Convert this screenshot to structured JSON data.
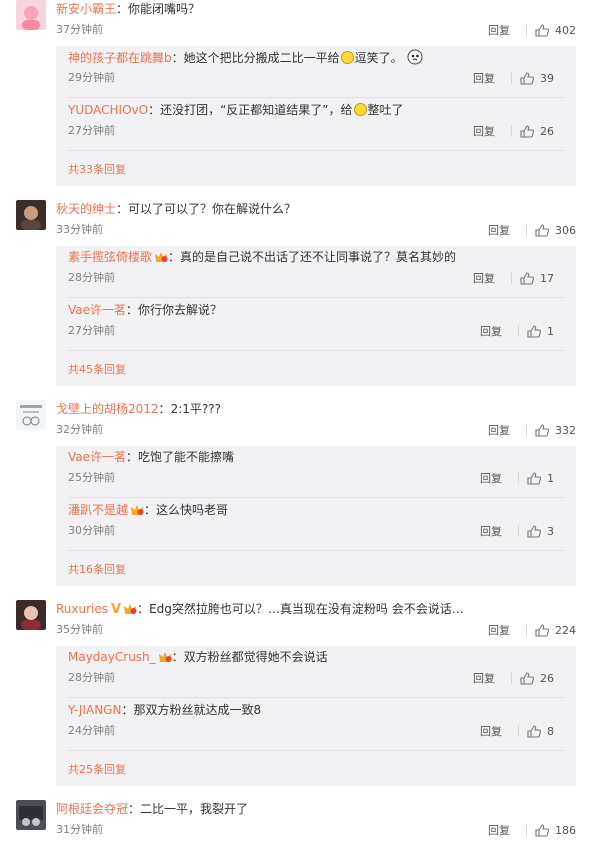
{
  "labels": {
    "reply": "回复"
  },
  "comments": [
    {
      "user": "新安小霸王",
      "text": "你能闭嘴吗？",
      "time": "37分钟前",
      "likes": "402",
      "replies": [
        {
          "user": "神的孩子都在跳舞b",
          "text": "她这个把比分搬成二比一平给",
          "text_after": "逗笑了。",
          "time": "29分钟前",
          "likes": "39"
        },
        {
          "user": "YUDACHIOvO",
          "text": "还没打团，“反正都知道结果了”，给",
          "text_after": "整吐了",
          "time": "27分钟前",
          "likes": "26"
        }
      ],
      "more": "共33条回复"
    },
    {
      "user": "秋天的绅士",
      "text": "可以了可以了？你在解说什么？",
      "time": "33分钟前",
      "likes": "306",
      "replies": [
        {
          "user": "素手揽弦倚楼歌",
          "text": "真的是自己说不出话了还不让同事说了？莫名其妙的",
          "time": "28分钟前",
          "likes": "17"
        },
        {
          "user": "Vae许一茗",
          "text": "你行你去解说？",
          "time": "27分钟前",
          "likes": "1"
        }
      ],
      "more": "共45条回复"
    },
    {
      "user": "戈壁上的胡杨2012",
      "text": "2:1平???",
      "time": "32分钟前",
      "likes": "332",
      "replies": [
        {
          "user": "Vae许一茗",
          "text": "吃饱了能不能擦嘴",
          "time": "25分钟前",
          "likes": "1"
        },
        {
          "user": "潘趴不是越",
          "text": "这么快吗老哥",
          "time": "30分钟前",
          "likes": "3"
        }
      ],
      "more": "共16条回复"
    },
    {
      "user": "Ruxuries",
      "text": "Edg突然拉胯也可以？…真当现在没有淀粉吗 会不会说话…",
      "time": "35分钟前",
      "likes": "224",
      "replies": [
        {
          "user": "MaydayCrush_",
          "text": "双方粉丝都觉得她不会说话",
          "time": "28分钟前",
          "likes": "26"
        },
        {
          "user": "Y-JIANGN",
          "text": "那双方粉丝就达成一致8",
          "time": "24分钟前",
          "likes": "8"
        }
      ],
      "more": "共25条回复"
    },
    {
      "user": "阿根廷会夺冠",
      "text": "二比一平，我裂开了",
      "time": "31分钟前",
      "likes": "186",
      "replies": []
    }
  ],
  "colors": {
    "username": "#eb7350",
    "reply_bg": "#f2f2f5",
    "badge": "#f5a623"
  }
}
